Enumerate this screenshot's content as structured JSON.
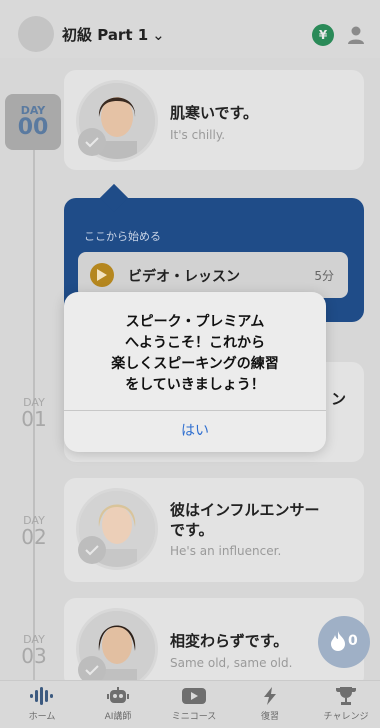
{
  "header": {
    "course": "初級 Part 1",
    "coin_symbol": "¥"
  },
  "timeline": [
    {
      "day_top": "DAY",
      "day_num": "00"
    },
    {
      "day_top": "DAY",
      "day_num": "01"
    },
    {
      "day_top": "DAY",
      "day_num": "02"
    },
    {
      "day_top": "DAY",
      "day_num": "03"
    }
  ],
  "cards": [
    {
      "jp": "肌寒いです。",
      "en": "It's chilly."
    },
    {
      "jp": "彼はインフルエンサー\nです。",
      "en": "He's an influencer."
    },
    {
      "jp": "相変わらずです。",
      "en": "Same old, same old."
    }
  ],
  "start": {
    "label": "ここから始める",
    "lesson": "ビデオ・レッスン",
    "minutes": "5分"
  },
  "dialog": {
    "message": "スピーク・プレミアム\nへようこそ！これから\n楽しくスピーキングの練習\nをしていきましょう！",
    "ok": "はい"
  },
  "streak": {
    "count": "0"
  },
  "nav": [
    {
      "label": "ホーム",
      "icon": "home-waveform-icon"
    },
    {
      "label": "AI講師",
      "icon": "robot-icon"
    },
    {
      "label": "ミニコース",
      "icon": "play-video-icon"
    },
    {
      "label": "復習",
      "icon": "bolt-icon"
    },
    {
      "label": "チャレンジ",
      "icon": "trophy-icon"
    }
  ]
}
